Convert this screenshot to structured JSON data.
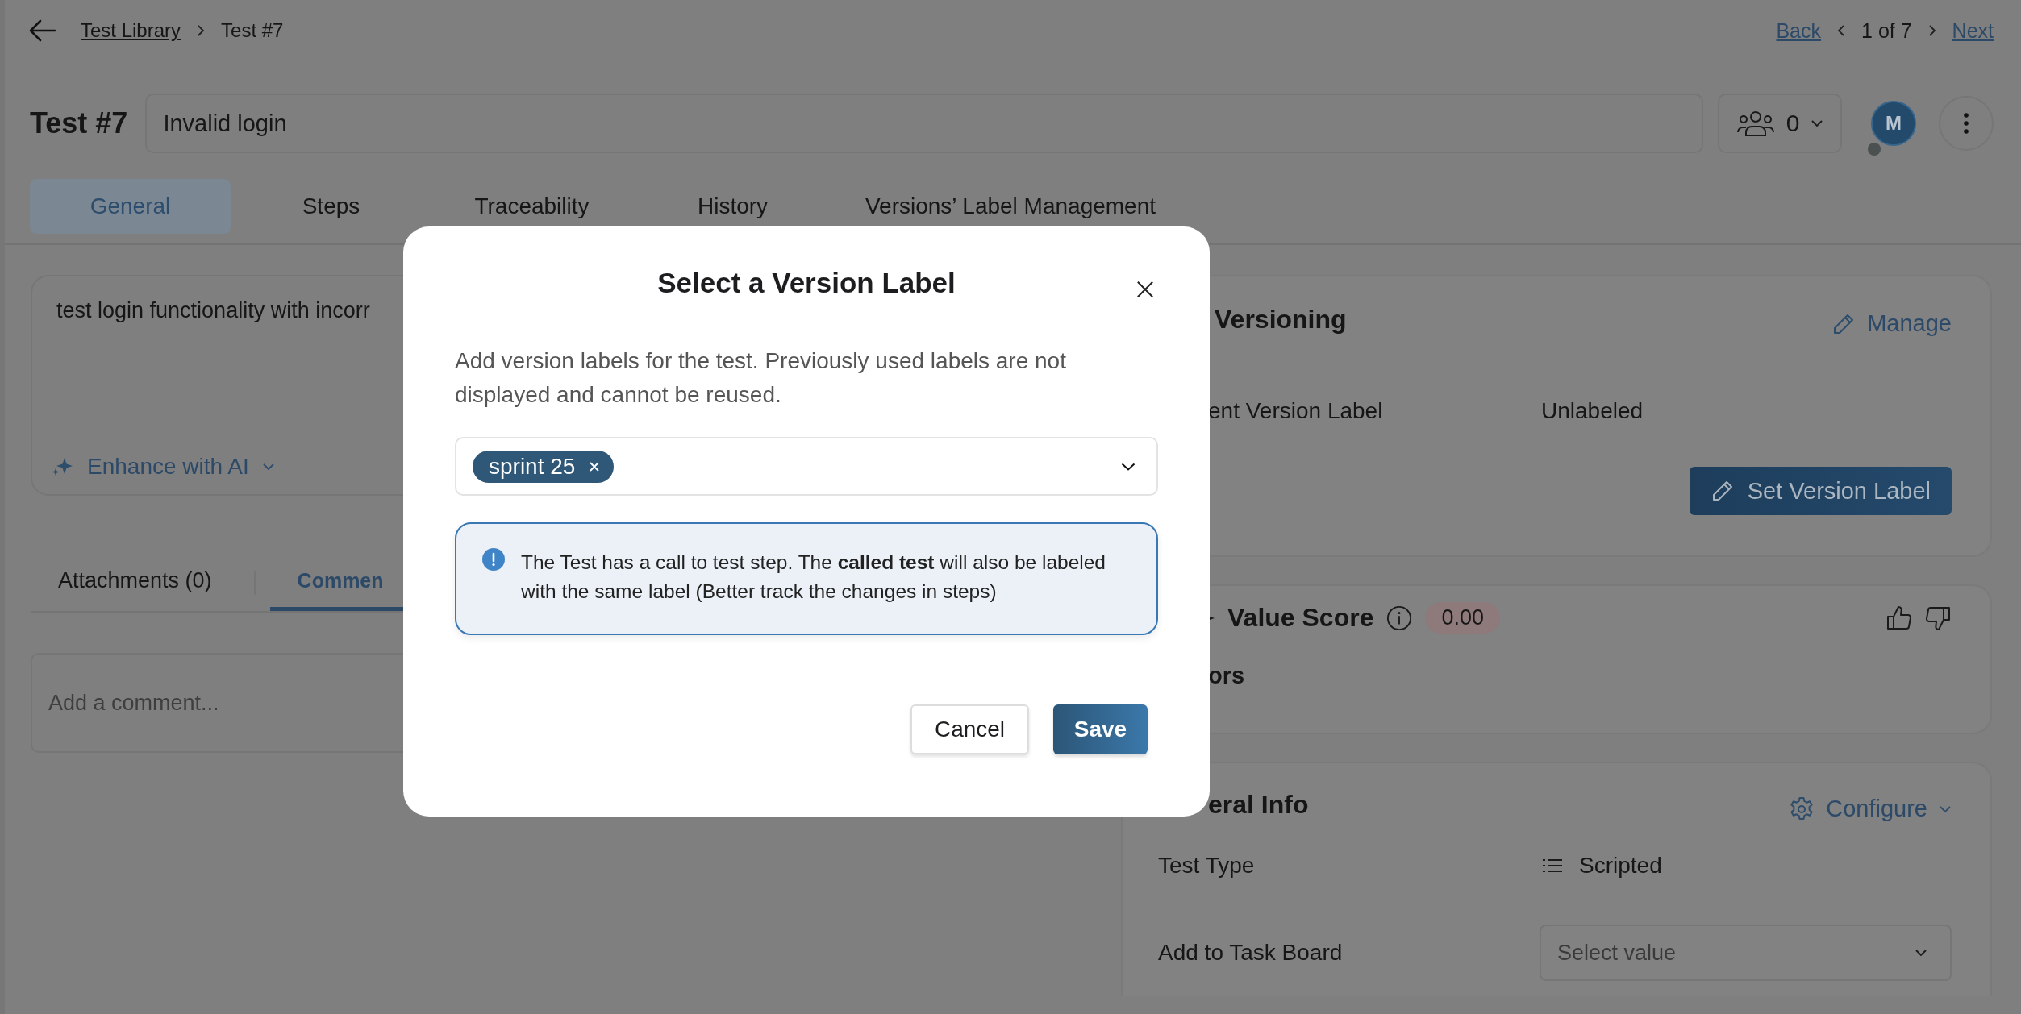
{
  "breadcrumb": [
    {
      "label": "Test Library",
      "kind": "link"
    },
    {
      "label": "Test #7",
      "kind": "current"
    }
  ],
  "pager": {
    "back": "Back",
    "position": "1 of 7",
    "next": "Next"
  },
  "header": {
    "test_id": "Test #7",
    "title": "Invalid login",
    "watchers": "0",
    "avatar": "M",
    "avatar_online": false
  },
  "tabs": [
    {
      "label": "General",
      "selected": true
    },
    {
      "label": "Steps",
      "selected": false
    },
    {
      "label": "Traceability",
      "selected": false
    },
    {
      "label": "History",
      "selected": false
    },
    {
      "label": "Versions’ Label Management",
      "selected": false
    }
  ],
  "description": {
    "text": "test login functionality with incorr",
    "enhance": "Enhance with AI"
  },
  "subtabs": [
    {
      "label": "Attachments (0)",
      "selected": false
    },
    {
      "label": "Commen",
      "selected": true
    }
  ],
  "comment": {
    "placeholder": "Add a comment..."
  },
  "versioning": {
    "title": "Versioning",
    "action": "Manage",
    "field_label": "ent Version Label",
    "field_value": "Unlabeled",
    "button": "Set Version Label"
  },
  "value_score": {
    "title": "Value Score",
    "score": "0.00",
    "subtitle": "ors"
  },
  "general_info": {
    "title": "eral Info",
    "action": "Configure",
    "fields": [
      {
        "label": "Test Type",
        "kind": "text",
        "value": "Scripted"
      },
      {
        "label": "Add to Task Board",
        "kind": "select",
        "placeholder": "Select value"
      }
    ]
  },
  "dialog": {
    "title": "Select a Version Label",
    "description": "Add version labels for the test. Previously used labels are not displayed and cannot be reused.",
    "selected_labels": [
      "sprint 25"
    ],
    "notice": "The Test has a call to test step. The **called test** will also be labeled with the same label (Better track the changes in steps)",
    "buttons": [
      {
        "label": "Cancel",
        "kind": "secondary"
      },
      {
        "label": "Save",
        "kind": "primary"
      }
    ]
  }
}
